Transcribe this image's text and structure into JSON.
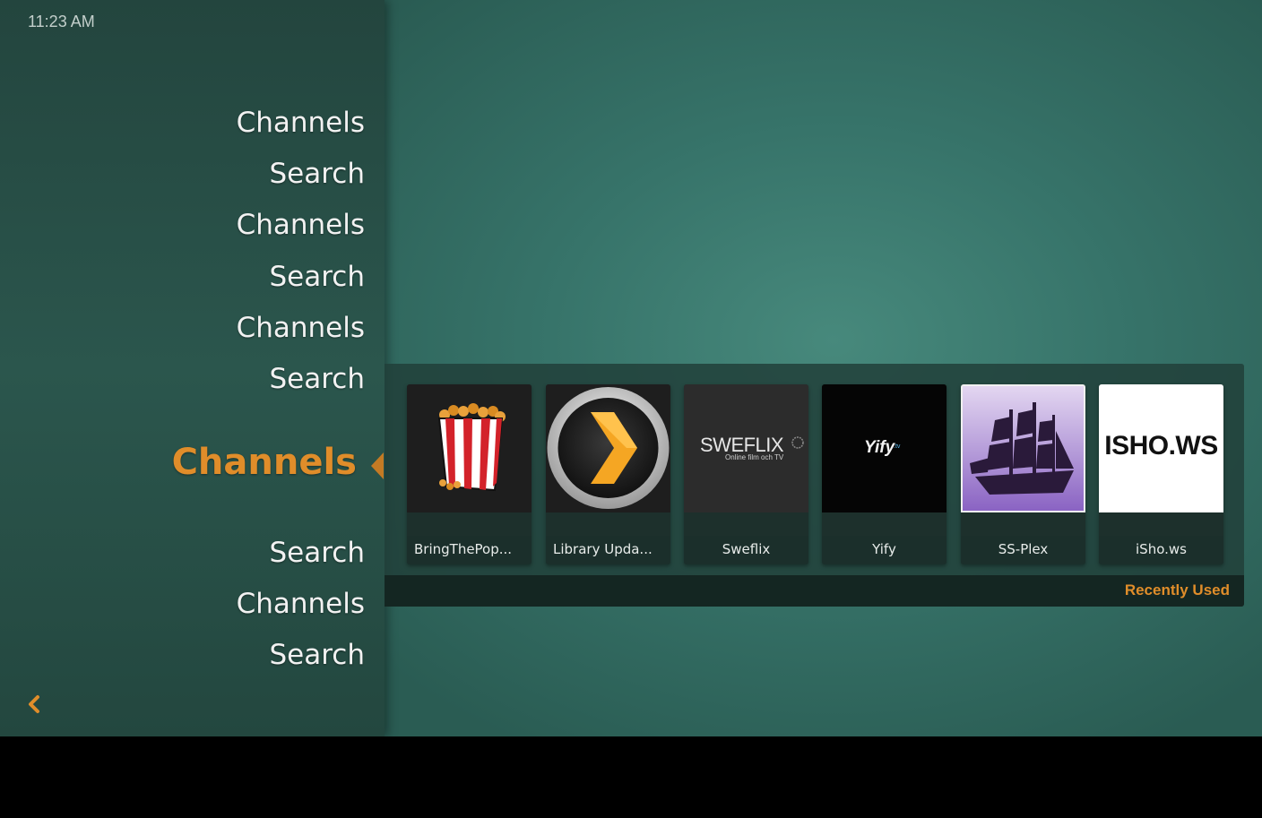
{
  "clock": "11:23 AM",
  "menu": {
    "items": [
      {
        "label": "Channels"
      },
      {
        "label": "Search"
      },
      {
        "label": "Channels"
      },
      {
        "label": "Search"
      },
      {
        "label": "Channels"
      },
      {
        "label": "Search"
      },
      {
        "label": "Channels",
        "active": true
      },
      {
        "label": "Search"
      },
      {
        "label": "Channels"
      },
      {
        "label": "Search"
      }
    ]
  },
  "recent": {
    "title": "Recently Used",
    "tiles": [
      {
        "label": "BringThePop...",
        "icon": "popcorn-icon"
      },
      {
        "label": "Library Upda...",
        "icon": "plex-chevron-icon"
      },
      {
        "label": "Sweflix",
        "icon": "sweflix-logo",
        "logo_text": "SWEFLIX",
        "logo_sub": "Online film och TV"
      },
      {
        "label": "Yify",
        "icon": "yify-logo",
        "logo_text": "Yify",
        "logo_sub": ".tv"
      },
      {
        "label": "SS-Plex",
        "icon": "ship-icon"
      },
      {
        "label": "iSho.ws",
        "icon": "ishows-logo",
        "logo_text": "ISHO.WS"
      }
    ]
  },
  "colors": {
    "accent": "#e08d2a",
    "background": "#37746a",
    "sidebar": "#2b564d"
  }
}
